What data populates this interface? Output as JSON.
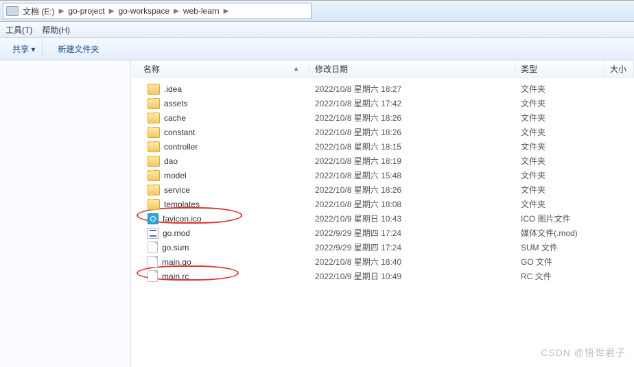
{
  "breadcrumbs": {
    "root": "文档 (E:)",
    "items": [
      "go-project",
      "go-workspace",
      "web-learn"
    ]
  },
  "menubar": {
    "tools": "工具(T)",
    "help": "帮助(H)"
  },
  "toolbar": {
    "share": "共享 ▾",
    "new_folder": "新建文件夹"
  },
  "columns": {
    "name": "名称",
    "date": "修改日期",
    "type": "类型",
    "size": "大小"
  },
  "files": [
    {
      "icon": "folder",
      "name": ".idea",
      "date": "2022/10/8 星期六 18:27",
      "type": "文件夹"
    },
    {
      "icon": "folder",
      "name": "assets",
      "date": "2022/10/8 星期六 17:42",
      "type": "文件夹"
    },
    {
      "icon": "folder",
      "name": "cache",
      "date": "2022/10/8 星期六 18:26",
      "type": "文件夹"
    },
    {
      "icon": "folder",
      "name": "constant",
      "date": "2022/10/8 星期六 18:26",
      "type": "文件夹"
    },
    {
      "icon": "folder",
      "name": "controller",
      "date": "2022/10/8 星期六 18:15",
      "type": "文件夹"
    },
    {
      "icon": "folder",
      "name": "dao",
      "date": "2022/10/8 星期六 18:19",
      "type": "文件夹"
    },
    {
      "icon": "folder",
      "name": "model",
      "date": "2022/10/8 星期六 15:48",
      "type": "文件夹"
    },
    {
      "icon": "folder",
      "name": "service",
      "date": "2022/10/8 星期六 18:26",
      "type": "文件夹"
    },
    {
      "icon": "folder",
      "name": "templates",
      "date": "2022/10/8 星期六 18:08",
      "type": "文件夹"
    },
    {
      "icon": "ico",
      "name": "favicon.ico",
      "date": "2022/10/9 星期日 10:43",
      "type": "ICO 图片文件"
    },
    {
      "icon": "mod",
      "name": "go.mod",
      "date": "2022/9/29 星期四 17:24",
      "type": "媒体文件(.mod)"
    },
    {
      "icon": "file",
      "name": "go.sum",
      "date": "2022/9/29 星期四 17:24",
      "type": "SUM 文件"
    },
    {
      "icon": "file",
      "name": "main.go",
      "date": "2022/10/8 星期六 18:40",
      "type": "GO 文件"
    },
    {
      "icon": "file",
      "name": "main.rc",
      "date": "2022/10/9 星期日 10:49",
      "type": "RC 文件"
    }
  ],
  "watermark": "CSDN @悟世君子"
}
